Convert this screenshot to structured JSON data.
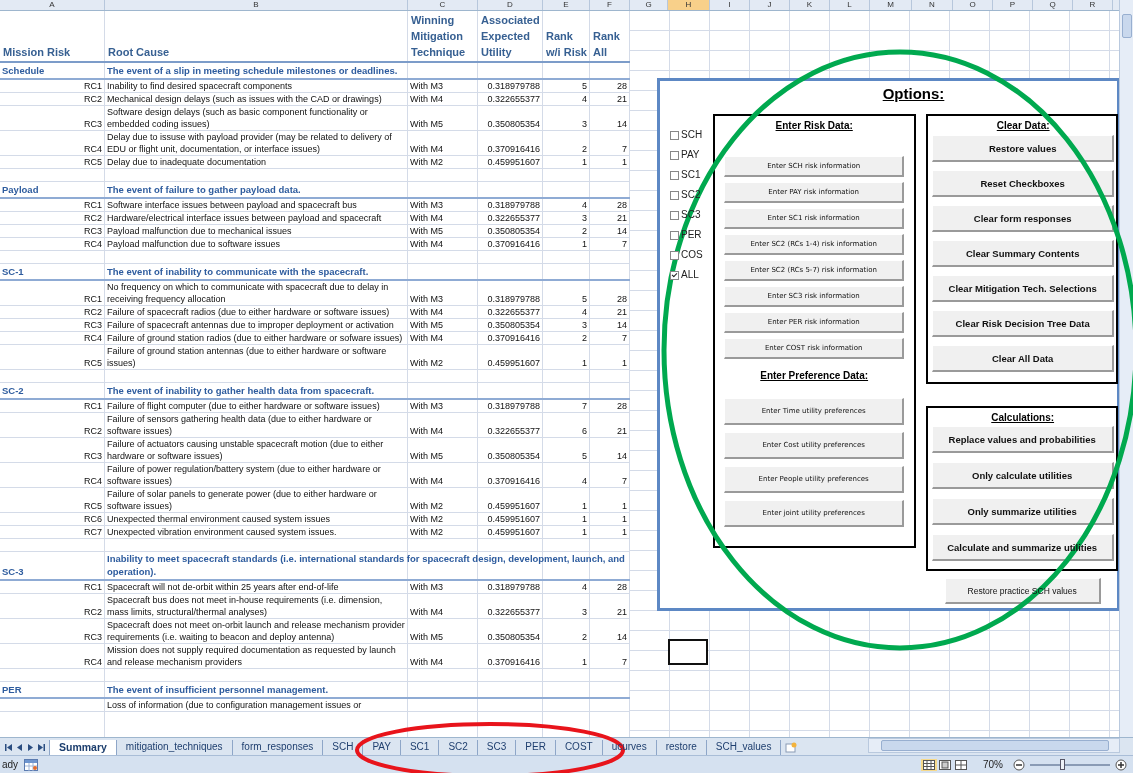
{
  "column_letters": [
    {
      "label": "A",
      "selected": false
    },
    {
      "label": "B",
      "selected": false
    },
    {
      "label": "C",
      "selected": false
    },
    {
      "label": "D",
      "selected": false
    },
    {
      "label": "E",
      "selected": false
    },
    {
      "label": "F",
      "selected": false
    },
    {
      "label": "G",
      "selected": false
    },
    {
      "label": "H",
      "selected": true
    },
    {
      "label": "I",
      "selected": false
    },
    {
      "label": "J",
      "selected": false
    },
    {
      "label": "K",
      "selected": false
    },
    {
      "label": "L",
      "selected": false
    },
    {
      "label": "M",
      "selected": false
    },
    {
      "label": "N",
      "selected": false
    },
    {
      "label": "O",
      "selected": false
    },
    {
      "label": "P",
      "selected": false
    },
    {
      "label": "Q",
      "selected": false
    },
    {
      "label": "R",
      "selected": false
    }
  ],
  "table": {
    "columns": [
      "Mission Risk",
      "Root Cause",
      "Winning Mitigation Technique",
      "Associated Expected Utility",
      "Rank w/i Risk",
      "Rank All"
    ],
    "groups": [
      {
        "risk": "Schedule",
        "event": "The event of a slip in meeting schedule milestones or deadlines.",
        "rows": [
          {
            "id": "RC1",
            "cause": "Inability to find desired spacecraft components",
            "technique": "With M3",
            "utility": "0.318979788",
            "rank_in_risk": "5",
            "rank_all": "28"
          },
          {
            "id": "RC2",
            "cause": "Mechanical design delays (such as issues with the CAD or drawings)",
            "technique": "With M4",
            "utility": "0.322655377",
            "rank_in_risk": "4",
            "rank_all": "21"
          },
          {
            "id": "RC3",
            "cause": "Software design delays (such as basic component functionality or embedded coding issues)",
            "technique": "With M5",
            "utility": "0.350805354",
            "rank_in_risk": "3",
            "rank_all": "14"
          },
          {
            "id": "RC4",
            "cause": "Delay due to issuse with payload provider (may be related to delivery of EDU or flight unit, documentation, or interface issues)",
            "technique": "With M4",
            "utility": "0.370916416",
            "rank_in_risk": "2",
            "rank_all": "7"
          },
          {
            "id": "RC5",
            "cause": "Delay due to inadequate documentation",
            "technique": "With M2",
            "utility": "0.459951607",
            "rank_in_risk": "1",
            "rank_all": "1"
          }
        ]
      },
      {
        "risk": "Payload",
        "event": "The event of failure to gather payload data.",
        "rows": [
          {
            "id": "RC1",
            "cause": "Software interface issues between payload and spacecraft bus",
            "technique": "With M3",
            "utility": "0.318979788",
            "rank_in_risk": "4",
            "rank_all": "28"
          },
          {
            "id": "RC2",
            "cause": "Hardware/electrical interface issues between payload and spacecraft",
            "technique": "With M4",
            "utility": "0.322655377",
            "rank_in_risk": "3",
            "rank_all": "21"
          },
          {
            "id": "RC3",
            "cause": "Payload malfunction due to mechanical issues",
            "technique": "With M5",
            "utility": "0.350805354",
            "rank_in_risk": "2",
            "rank_all": "14"
          },
          {
            "id": "RC4",
            "cause": "Payload malfunction due to software issues",
            "technique": "With M4",
            "utility": "0.370916416",
            "rank_in_risk": "1",
            "rank_all": "7"
          }
        ]
      },
      {
        "risk": "SC-1",
        "event": "The event of inability to communicate with the spacecraft.",
        "rows": [
          {
            "id": "RC1",
            "cause": "No frequency on which to communicate with spacecraft due to delay in receiving frequency allocation",
            "technique": "With M3",
            "utility": "0.318979788",
            "rank_in_risk": "5",
            "rank_all": "28"
          },
          {
            "id": "RC2",
            "cause": "Failure of spacecraft radios (due to either hardware or software issues)",
            "technique": "With M4",
            "utility": "0.322655377",
            "rank_in_risk": "4",
            "rank_all": "21"
          },
          {
            "id": "RC3",
            "cause": "Failure of spacecraft antennas due to improper deployment or activation",
            "technique": "With M5",
            "utility": "0.350805354",
            "rank_in_risk": "3",
            "rank_all": "14"
          },
          {
            "id": "RC4",
            "cause": "Failure of ground station radios (due to either hardware or sofware issues)",
            "technique": "With M4",
            "utility": "0.370916416",
            "rank_in_risk": "2",
            "rank_all": "7"
          },
          {
            "id": "RC5",
            "cause": "Failure of ground station antennas (due to either hardware or software issues)",
            "technique": "With M2",
            "utility": "0.459951607",
            "rank_in_risk": "1",
            "rank_all": "1"
          }
        ]
      },
      {
        "risk": "SC-2",
        "event": "The event of inability to gather health data from spacecraft.",
        "rows": [
          {
            "id": "RC1",
            "cause": "Failure of flight computer (due to either hardware or software issues)",
            "technique": "With M3",
            "utility": "0.318979788",
            "rank_in_risk": "7",
            "rank_all": "28"
          },
          {
            "id": "RC2",
            "cause": "Failure of sensors gathering health data (due to either hardware or software issues)",
            "technique": "With M4",
            "utility": "0.322655377",
            "rank_in_risk": "6",
            "rank_all": "21"
          },
          {
            "id": "RC3",
            "cause": "Failure of actuators causing unstable spacecraft motion (due to either hardware or software issues)",
            "technique": "With M5",
            "utility": "0.350805354",
            "rank_in_risk": "5",
            "rank_all": "14"
          },
          {
            "id": "RC4",
            "cause": "Failure of power regulation/battery system (due to either hardware or software issues)",
            "technique": "With M4",
            "utility": "0.370916416",
            "rank_in_risk": "4",
            "rank_all": "7"
          },
          {
            "id": "RC5",
            "cause": "Failure of solar panels to generate power (due to either hardware or software issues)",
            "technique": "With M2",
            "utility": "0.459951607",
            "rank_in_risk": "1",
            "rank_all": "1"
          },
          {
            "id": "RC6",
            "cause": "Unexpected thermal environment caused system issues",
            "technique": "With M2",
            "utility": "0.459951607",
            "rank_in_risk": "1",
            "rank_all": "1"
          },
          {
            "id": "RC7",
            "cause": "Unexpected vibration environment caused system issues.",
            "technique": "With M2",
            "utility": "0.459951607",
            "rank_in_risk": "1",
            "rank_all": "1"
          }
        ]
      },
      {
        "risk": "SC-3",
        "event": "Inability to meet spacecraft standards (i.e. international standards for spacecraft design, development, launch, and operation).",
        "rows": [
          {
            "id": "RC1",
            "cause": "Spacecraft will not de-orbit within 25 years after end-of-life",
            "technique": "With M3",
            "utility": "0.318979788",
            "rank_in_risk": "4",
            "rank_all": "28"
          },
          {
            "id": "RC2",
            "cause": "Spacecraft bus does not meet in-house requirements (i.e. dimension, mass limits, structural/thermal analyses)",
            "technique": "With M4",
            "utility": "0.322655377",
            "rank_in_risk": "3",
            "rank_all": "21"
          },
          {
            "id": "RC3",
            "cause": "Spacecraft does not meet on-orbit launch and release mechanism provider requirements (i.e. waiting to beacon and deploy antenna)",
            "technique": "With M5",
            "utility": "0.350805354",
            "rank_in_risk": "2",
            "rank_all": "14"
          },
          {
            "id": "RC4",
            "cause": "Mission does not supply required documentation as requested by launch and release mechanism providers",
            "technique": "With M4",
            "utility": "0.370916416",
            "rank_in_risk": "1",
            "rank_all": "7"
          }
        ]
      },
      {
        "risk": "PER",
        "event": "The event of insufficient personnel management.",
        "rows": [
          {
            "cause": "Loss of information (due to configuration management issues or"
          }
        ]
      }
    ]
  },
  "options_panel": {
    "title": "Options:",
    "checkboxes": [
      {
        "label": "SCH",
        "checked": false
      },
      {
        "label": "PAY",
        "checked": false
      },
      {
        "label": "SC1",
        "checked": false
      },
      {
        "label": "SC2",
        "checked": false
      },
      {
        "label": "SC3",
        "checked": false
      },
      {
        "label": "PER",
        "checked": false
      },
      {
        "label": "COS",
        "checked": false
      },
      {
        "label": "ALL",
        "checked": true
      }
    ],
    "risk_data": {
      "title": "Enter Risk Data:",
      "buttons": [
        "Enter SCH risk information",
        "Enter PAY risk information",
        "Enter SC1 risk information",
        "Enter SC2 (RCs 1-4) risk information",
        "Enter SC2 (RCs 5-7) risk information",
        "Enter SC3 risk information",
        "Enter PER risk information",
        "Enter COST risk information"
      ]
    },
    "preference_data": {
      "title": "Enter Preference Data:",
      "buttons": [
        "Enter Time utility preferences",
        "Enter Cost utility preferences",
        "Enter People utility preferences",
        "Enter joint utility preferences"
      ]
    },
    "clear_data": {
      "title": "Clear Data:",
      "buttons": [
        "Restore values",
        "Reset Checkboxes",
        "Clear form responses",
        "Clear Summary Contents",
        "Clear Mitigation Tech. Selections",
        "Clear Risk Decision Tree Data",
        "Clear All Data"
      ]
    },
    "calculations": {
      "title": "Calculations:",
      "buttons": [
        "Replace values and probabilities",
        "Only calculate utilities",
        "Only summarize utilities",
        "Calculate and summarize utilities"
      ]
    },
    "extra_button": "Restore practice SCH values"
  },
  "sheet_tabs": [
    {
      "label": "Summary",
      "selected": true
    },
    {
      "label": "mitigation_techniques",
      "selected": false
    },
    {
      "label": "form_responses",
      "selected": false
    },
    {
      "label": "SCH",
      "selected": false
    },
    {
      "label": "PAY",
      "selected": false
    },
    {
      "label": "SC1",
      "selected": false
    },
    {
      "label": "SC2",
      "selected": false
    },
    {
      "label": "SC3",
      "selected": false
    },
    {
      "label": "PER",
      "selected": false
    },
    {
      "label": "COST",
      "selected": false
    },
    {
      "label": "ucurves",
      "selected": false
    },
    {
      "label": "restore",
      "selected": false
    },
    {
      "label": "SCH_values",
      "selected": false
    }
  ],
  "status_bar": {
    "mode": "ady",
    "zoom": "70%",
    "zoom_slider": {
      "level": 0.4
    }
  }
}
